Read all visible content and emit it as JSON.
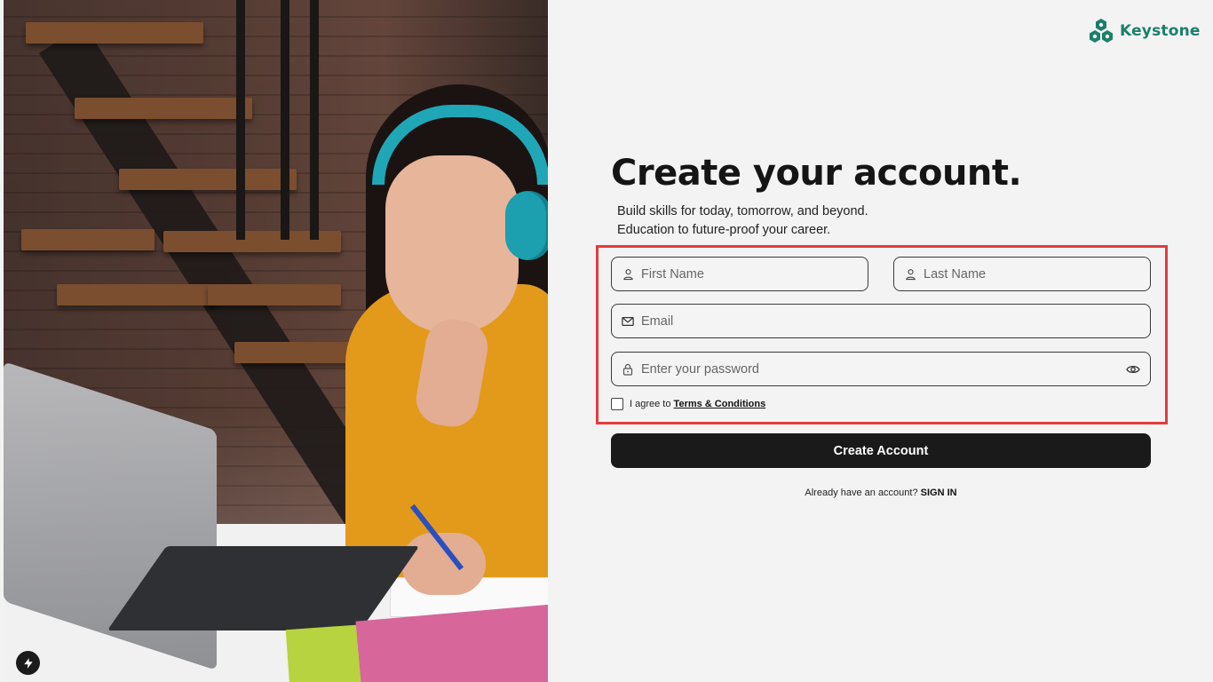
{
  "brand": {
    "name": "Keystone",
    "accent": "#1b7f6a"
  },
  "heading": {
    "title": "Create your account.",
    "line1": "Build skills for today, tomorrow, and beyond.",
    "line2": "Education to future-proof your career."
  },
  "form": {
    "first_name_placeholder": "First Name",
    "last_name_placeholder": "Last Name",
    "email_placeholder": "Email",
    "password_placeholder": "Enter your password",
    "agree_prefix": "I agree to ",
    "terms_link": "Terms & Conditions",
    "submit_label": "Create Account"
  },
  "footer": {
    "prompt": "Already have an account? ",
    "signin_link": "SIGN IN"
  },
  "icons": {
    "first_name": "user-icon",
    "last_name": "user-icon",
    "email": "mail-icon",
    "password": "lock-icon",
    "toggle_password": "eye-icon",
    "badge": "lightning-bolt-icon"
  },
  "colors": {
    "highlight": "#e53b3b",
    "button": "#1a1a1a",
    "panel_bg": "#f3f3f3"
  }
}
